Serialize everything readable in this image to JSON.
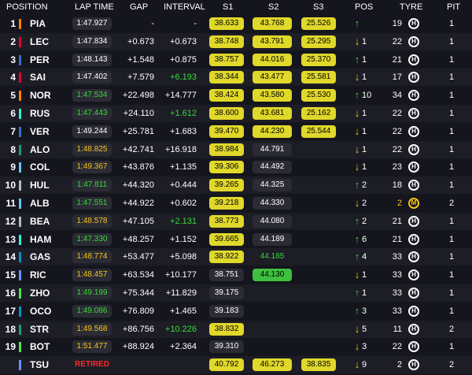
{
  "header": {
    "position": "POSITION",
    "lap_time": "LAP TIME",
    "gap": "GAP",
    "interval": "INTERVAL",
    "s1": "S1",
    "s2": "S2",
    "s3": "S3",
    "pos": "POS",
    "tyre": "TYRE",
    "pit": "PIT"
  },
  "colors": {
    "background": "#15151e",
    "row_alt": "#1d1d26",
    "sector_yellow": "#e0d82a",
    "sector_green": "#3fc03f",
    "purple_text": "#39d839",
    "retired": "#ff2a2a"
  },
  "rows": [
    {
      "pos": "1",
      "drv": "PIA",
      "team_color": "#ff8000",
      "lap": "1:47.927",
      "lap_style": "grey",
      "gap": "-",
      "int": "-",
      "int_style": "",
      "s1": "38.633",
      "s1_style": "yellow",
      "s2": "43.768",
      "s2_style": "yellow",
      "s3": "25.526",
      "s3_style": "yellow",
      "arrow": "up",
      "pch": "",
      "age": "19",
      "tyre": "H",
      "pit": "1"
    },
    {
      "pos": "2",
      "drv": "LEC",
      "team_color": "#e8002d",
      "lap": "1:47.834",
      "lap_style": "grey",
      "gap": "+0.673",
      "int": "+0.673",
      "int_style": "",
      "s1": "38.748",
      "s1_style": "yellow",
      "s2": "43.791",
      "s2_style": "yellow",
      "s3": "25.295",
      "s3_style": "yellow",
      "arrow": "down",
      "pch": "1",
      "age": "22",
      "tyre": "H",
      "pit": "1"
    },
    {
      "pos": "3",
      "drv": "PER",
      "team_color": "#3671c6",
      "lap": "1:48.143",
      "lap_style": "grey",
      "gap": "+1.548",
      "int": "+0.875",
      "int_style": "",
      "s1": "38.757",
      "s1_style": "yellow",
      "s2": "44.016",
      "s2_style": "yellow",
      "s3": "25.370",
      "s3_style": "yellow",
      "arrow": "up",
      "pch": "1",
      "age": "21",
      "tyre": "H",
      "pit": "1"
    },
    {
      "pos": "4",
      "drv": "SAI",
      "team_color": "#e8002d",
      "lap": "1:47.402",
      "lap_style": "grey",
      "gap": "+7.579",
      "int": "+6.193",
      "int_style": "green",
      "s1": "38.344",
      "s1_style": "yellow",
      "s2": "43.477",
      "s2_style": "yellow",
      "s3": "25.581",
      "s3_style": "yellow",
      "arrow": "down",
      "pch": "1",
      "age": "17",
      "tyre": "H",
      "pit": "1"
    },
    {
      "pos": "5",
      "drv": "NOR",
      "team_color": "#ff8000",
      "lap": "1:47.534",
      "lap_style": "greenText",
      "gap": "+22.498",
      "int": "+14.777",
      "int_style": "",
      "s1": "38.424",
      "s1_style": "yellow",
      "s2": "43.580",
      "s2_style": "yellow",
      "s3": "25.530",
      "s3_style": "yellow",
      "arrow": "up",
      "pch": "10",
      "age": "34",
      "tyre": "H",
      "pit": "1"
    },
    {
      "pos": "6",
      "drv": "RUS",
      "team_color": "#27f4d2",
      "lap": "1:47.443",
      "lap_style": "greenText",
      "gap": "+24.110",
      "int": "+1.612",
      "int_style": "green",
      "s1": "38.600",
      "s1_style": "yellow",
      "s2": "43.681",
      "s2_style": "yellow",
      "s3": "25.162",
      "s3_style": "yellow",
      "arrow": "down",
      "pch": "1",
      "age": "22",
      "tyre": "H",
      "pit": "1"
    },
    {
      "pos": "7",
      "drv": "VER",
      "team_color": "#3671c6",
      "lap": "1:49.244",
      "lap_style": "grey",
      "gap": "+25.781",
      "int": "+1.683",
      "int_style": "",
      "s1": "39.470",
      "s1_style": "yellow",
      "s2": "44.230",
      "s2_style": "yellow",
      "s3": "25.544",
      "s3_style": "yellow",
      "arrow": "down",
      "pch": "1",
      "age": "22",
      "tyre": "H",
      "pit": "1"
    },
    {
      "pos": "8",
      "drv": "ALO",
      "team_color": "#229971",
      "lap": "1:48.825",
      "lap_style": "yellowText",
      "gap": "+42.741",
      "int": "+16.918",
      "int_style": "",
      "s1": "38.984",
      "s1_style": "yellow",
      "s2": "44.791",
      "s2_style": "grey",
      "s3": "",
      "s3_style": "",
      "arrow": "down",
      "pch": "1",
      "age": "22",
      "tyre": "H",
      "pit": "1"
    },
    {
      "pos": "9",
      "drv": "COL",
      "team_color": "#64c4ff",
      "lap": "1:49.367",
      "lap_style": "yellowText",
      "gap": "+43.876",
      "int": "+1.135",
      "int_style": "",
      "s1": "39.306",
      "s1_style": "yellow",
      "s2": "44.492",
      "s2_style": "grey",
      "s3": "",
      "s3_style": "",
      "arrow": "down",
      "pch": "1",
      "age": "23",
      "tyre": "H",
      "pit": "1"
    },
    {
      "pos": "10",
      "drv": "HUL",
      "team_color": "#b6babd",
      "lap": "1:47.811",
      "lap_style": "greenText",
      "gap": "+44.320",
      "int": "+0.444",
      "int_style": "",
      "s1": "39.265",
      "s1_style": "yellow",
      "s2": "44.325",
      "s2_style": "grey",
      "s3": "",
      "s3_style": "",
      "arrow": "up",
      "pch": "2",
      "age": "18",
      "tyre": "H",
      "pit": "1"
    },
    {
      "pos": "11",
      "drv": "ALB",
      "team_color": "#64c4ff",
      "lap": "1:47.551",
      "lap_style": "greenText",
      "gap": "+44.922",
      "int": "+0.602",
      "int_style": "",
      "s1": "39.218",
      "s1_style": "yellow",
      "s2": "44.330",
      "s2_style": "grey",
      "s3": "",
      "s3_style": "",
      "arrow": "down",
      "pch": "2",
      "age": "2",
      "tyre": "M",
      "pit": "2"
    },
    {
      "pos": "12",
      "drv": "BEA",
      "team_color": "#b6babd",
      "lap": "1:48.578",
      "lap_style": "yellowText",
      "gap": "+47.105",
      "int": "+2.131",
      "int_style": "green",
      "s1": "38.773",
      "s1_style": "yellow",
      "s2": "44.080",
      "s2_style": "grey",
      "s3": "",
      "s3_style": "",
      "arrow": "up",
      "pch": "2",
      "age": "21",
      "tyre": "H",
      "pit": "1"
    },
    {
      "pos": "13",
      "drv": "HAM",
      "team_color": "#27f4d2",
      "lap": "1:47.330",
      "lap_style": "greenText",
      "gap": "+48.257",
      "int": "+1.152",
      "int_style": "",
      "s1": "39.665",
      "s1_style": "yellow",
      "s2": "44.189",
      "s2_style": "grey",
      "s3": "",
      "s3_style": "",
      "arrow": "up",
      "pch": "6",
      "age": "21",
      "tyre": "H",
      "pit": "1"
    },
    {
      "pos": "14",
      "drv": "GAS",
      "team_color": "#0093cc",
      "lap": "1:48.774",
      "lap_style": "yellowText",
      "gap": "+53.477",
      "int": "+5.098",
      "int_style": "",
      "s1": "38.922",
      "s1_style": "yellow",
      "s2": "44.185",
      "s2_style": "greenText",
      "s3": "",
      "s3_style": "",
      "arrow": "up",
      "pch": "4",
      "age": "33",
      "tyre": "H",
      "pit": "1"
    },
    {
      "pos": "15",
      "drv": "RIC",
      "team_color": "#6692ff",
      "lap": "1:48.457",
      "lap_style": "yellowText",
      "gap": "+63.534",
      "int": "+10.177",
      "int_style": "",
      "s1": "38.751",
      "s1_style": "grey",
      "s2": "44.130",
      "s2_style": "green",
      "s3": "",
      "s3_style": "",
      "arrow": "down",
      "pch": "1",
      "age": "33",
      "tyre": "H",
      "pit": "1"
    },
    {
      "pos": "16",
      "drv": "ZHO",
      "team_color": "#52e252",
      "lap": "1:49.199",
      "lap_style": "greenText",
      "gap": "+75.344",
      "int": "+11.829",
      "int_style": "",
      "s1": "39.175",
      "s1_style": "grey",
      "s2": "",
      "s2_style": "",
      "s3": "",
      "s3_style": "",
      "arrow": "up",
      "pch": "1",
      "age": "33",
      "tyre": "H",
      "pit": "1"
    },
    {
      "pos": "17",
      "drv": "OCO",
      "team_color": "#0093cc",
      "lap": "1:49.086",
      "lap_style": "greenText",
      "gap": "+76.809",
      "int": "+1.465",
      "int_style": "",
      "s1": "39.183",
      "s1_style": "grey",
      "s2": "",
      "s2_style": "",
      "s3": "",
      "s3_style": "",
      "arrow": "up",
      "pch": "3",
      "age": "33",
      "tyre": "H",
      "pit": "1"
    },
    {
      "pos": "18",
      "drv": "STR",
      "team_color": "#229971",
      "lap": "1:49.568",
      "lap_style": "yellowText",
      "gap": "+86.756",
      "int": "+10.226",
      "int_style": "green",
      "s1": "38.832",
      "s1_style": "yellow",
      "s2": "",
      "s2_style": "",
      "s3": "",
      "s3_style": "",
      "arrow": "down",
      "pch": "5",
      "age": "11",
      "tyre": "H",
      "pit": "2"
    },
    {
      "pos": "19",
      "drv": "BOT",
      "team_color": "#52e252",
      "lap": "1:51.477",
      "lap_style": "yellowText",
      "gap": "+88.924",
      "int": "+2.364",
      "int_style": "",
      "s1": "39.310",
      "s1_style": "grey",
      "s2": "",
      "s2_style": "",
      "s3": "",
      "s3_style": "",
      "arrow": "down",
      "pch": "3",
      "age": "22",
      "tyre": "H",
      "pit": "1"
    },
    {
      "pos": "",
      "drv": "TSU",
      "team_color": "#6692ff",
      "lap": "RETIRED",
      "lap_style": "retired",
      "gap": "",
      "int": "",
      "int_style": "",
      "s1": "40.792",
      "s1_style": "yellow",
      "s2": "46.273",
      "s2_style": "yellow",
      "s3": "38.835",
      "s3_style": "yellow",
      "arrow": "down",
      "pch": "9",
      "age": "2",
      "tyre": "H",
      "pit": "2"
    }
  ]
}
